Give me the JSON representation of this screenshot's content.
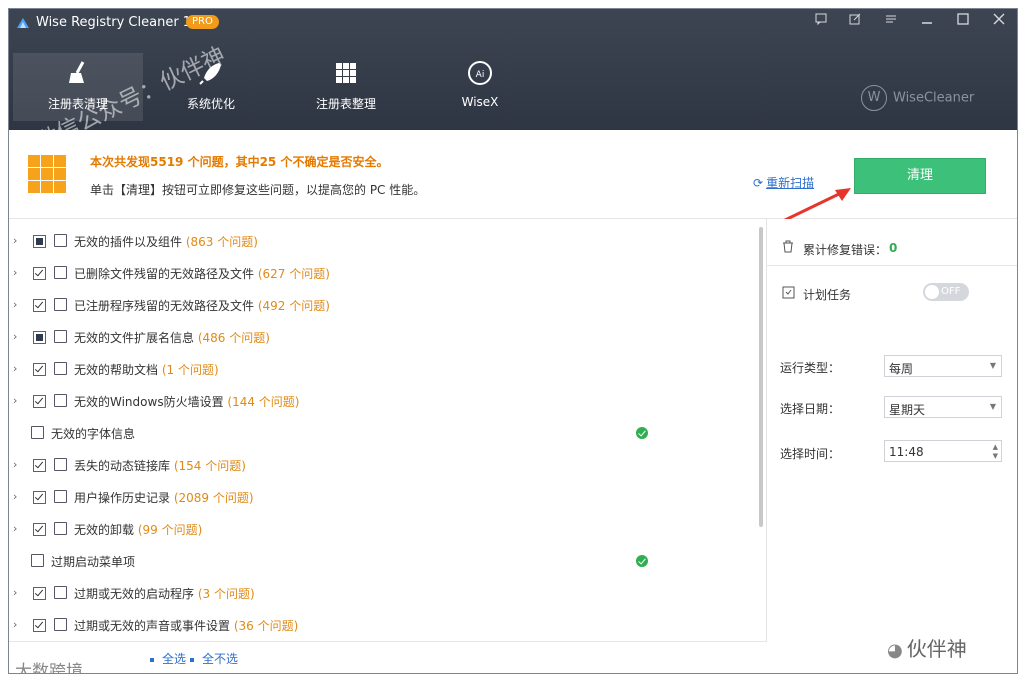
{
  "titlebar": {
    "app_title": "Wise Registry Cleaner 11",
    "badge": "PRO"
  },
  "nav": [
    {
      "label": "注册表清理",
      "icon": "broom-icon",
      "active": true
    },
    {
      "label": "系统优化",
      "icon": "rocket-icon",
      "active": false
    },
    {
      "label": "注册表整理",
      "icon": "grid-icon",
      "active": false
    },
    {
      "label": "WiseX",
      "icon": "ai-icon",
      "active": false
    }
  ],
  "brand": {
    "label": "WiseCleaner"
  },
  "summary": {
    "line1": "本次共发现5519 个问题，其中25 个不确定是否安全。",
    "line2": "单击【清理】按钮可立即修复这些问题，以提高您的 PC 性能。",
    "rescan_label": "重新扫描",
    "clean_label": "清理"
  },
  "items": [
    {
      "label": "无效的插件以及组件",
      "count": "(863 个问题)",
      "check": "partial",
      "expand": true,
      "ok": false,
      "icon": "plugin-icon"
    },
    {
      "label": "已删除文件残留的无效路径及文件",
      "count": "(627 个问题)",
      "check": "checked",
      "expand": true,
      "ok": false,
      "icon": "file-icon"
    },
    {
      "label": "已注册程序残留的无效路径及文件",
      "count": "(492 个问题)",
      "check": "checked",
      "expand": true,
      "ok": false,
      "icon": "window-icon"
    },
    {
      "label": "无效的文件扩展名信息",
      "count": "(486 个问题)",
      "check": "partial",
      "expand": true,
      "ok": false,
      "icon": "file-info-icon"
    },
    {
      "label": "无效的帮助文档",
      "count": "(1 个问题)",
      "check": "checked",
      "expand": true,
      "ok": false,
      "icon": "help-doc-icon"
    },
    {
      "label": "无效的Windows防火墙设置",
      "count": "(144 个问题)",
      "check": "checked",
      "expand": true,
      "ok": false,
      "icon": "firewall-icon"
    },
    {
      "label": "无效的字体信息",
      "count": "",
      "check": "none",
      "expand": false,
      "ok": true,
      "icon": "font-icon"
    },
    {
      "label": "丢失的动态链接库",
      "count": "(154 个问题)",
      "check": "checked",
      "expand": true,
      "ok": false,
      "icon": "dll-icon"
    },
    {
      "label": "用户操作历史记录",
      "count": "(2089 个问题)",
      "check": "checked",
      "expand": true,
      "ok": false,
      "icon": "history-icon"
    },
    {
      "label": "无效的卸载",
      "count": "(99 个问题)",
      "check": "checked",
      "expand": true,
      "ok": false,
      "icon": "uninstall-icon"
    },
    {
      "label": "过期启动菜单项",
      "count": "",
      "check": "none",
      "expand": false,
      "ok": true,
      "icon": "startmenu-icon"
    },
    {
      "label": "过期或无效的启动程序",
      "count": "(3 个问题)",
      "check": "checked",
      "expand": true,
      "ok": false,
      "icon": "startup-icon"
    },
    {
      "label": "过期或无效的声音或事件设置",
      "count": "(36 个问题)",
      "check": "checked",
      "expand": true,
      "ok": false,
      "icon": "sound-icon"
    }
  ],
  "footer": {
    "select_all": "全选",
    "select_none": "全不选"
  },
  "right": {
    "fixed_label": "累计修复错误：",
    "fixed_value": "0",
    "schedule_label": "计划任务",
    "toggle_label": "OFF",
    "run_type_label": "运行类型：",
    "run_type_value": "每周",
    "date_label": "选择日期：",
    "date_value": "星期天",
    "time_label": "选择时间：",
    "time_value": "11:48"
  },
  "watermarks": {
    "diagonal": "微信公众号：伙伴神",
    "bottom_right": "伙伴神",
    "bottom_left": "大数跨境"
  },
  "colors": {
    "header": "#343b48",
    "accent_orange": "#e57a00",
    "clean_button": "#3cc07a",
    "link": "#2e6fcc",
    "ok_green": "#2fae52"
  }
}
